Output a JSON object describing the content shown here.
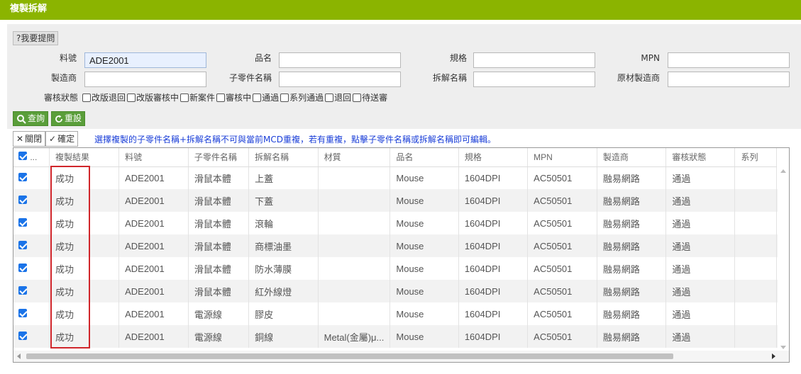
{
  "title": "複製拆解",
  "help_label": "?我要提問",
  "search": {
    "part_no_label": "料號",
    "part_no_value": "ADE2001",
    "name_label": "品名",
    "name_value": "",
    "spec_label": "規格",
    "spec_value": "",
    "mpn_label": "MPN",
    "mpn_value": "",
    "maker_label": "製造商",
    "maker_value": "",
    "subpart_label": "子零件名稱",
    "subpart_value": "",
    "disassembly_label": "拆解名稱",
    "disassembly_value": "",
    "raw_maker_label": "原材製造商",
    "raw_maker_value": ""
  },
  "status_filter": {
    "label": "審核狀態",
    "options": [
      "改版退回",
      "改版審核中",
      "新案件",
      "審核中",
      "通過",
      "系列通過",
      "退回",
      "待送審"
    ]
  },
  "buttons": {
    "query": "查詢",
    "reset": "重設",
    "close": "關閉",
    "confirm": "確定"
  },
  "notice": "選擇複製的子零件名稱+拆解名稱不可與當前MCD重複，若有重複，點擊子零件名稱或拆解名稱即可編輯。",
  "table": {
    "select_all_checked": true,
    "header_ellipsis": "...",
    "columns": [
      "複製結果",
      "料號",
      "子零件名稱",
      "拆解名稱",
      "材質",
      "品名",
      "規格",
      "MPN",
      "製造商",
      "審核狀態",
      "系列"
    ],
    "rows": [
      {
        "checked": true,
        "result": "成功",
        "part_no": "ADE2001",
        "subpart": "滑鼠本體",
        "disassembly": "上蓋",
        "material": "",
        "name": "Mouse",
        "spec": "1604DPI",
        "mpn": "AC50501",
        "maker": "融易網路",
        "status": "通過",
        "series": ""
      },
      {
        "checked": true,
        "result": "成功",
        "part_no": "ADE2001",
        "subpart": "滑鼠本體",
        "disassembly": "下蓋",
        "material": "",
        "name": "Mouse",
        "spec": "1604DPI",
        "mpn": "AC50501",
        "maker": "融易網路",
        "status": "通過",
        "series": ""
      },
      {
        "checked": true,
        "result": "成功",
        "part_no": "ADE2001",
        "subpart": "滑鼠本體",
        "disassembly": "滾輪",
        "material": "",
        "name": "Mouse",
        "spec": "1604DPI",
        "mpn": "AC50501",
        "maker": "融易網路",
        "status": "通過",
        "series": ""
      },
      {
        "checked": true,
        "result": "成功",
        "part_no": "ADE2001",
        "subpart": "滑鼠本體",
        "disassembly": "商標油墨",
        "material": "",
        "name": "Mouse",
        "spec": "1604DPI",
        "mpn": "AC50501",
        "maker": "融易網路",
        "status": "通過",
        "series": ""
      },
      {
        "checked": true,
        "result": "成功",
        "part_no": "ADE2001",
        "subpart": "滑鼠本體",
        "disassembly": "防水薄膜",
        "material": "",
        "name": "Mouse",
        "spec": "1604DPI",
        "mpn": "AC50501",
        "maker": "融易網路",
        "status": "通過",
        "series": ""
      },
      {
        "checked": true,
        "result": "成功",
        "part_no": "ADE2001",
        "subpart": "滑鼠本體",
        "disassembly": "紅外線燈",
        "material": "",
        "name": "Mouse",
        "spec": "1604DPI",
        "mpn": "AC50501",
        "maker": "融易網路",
        "status": "通過",
        "series": ""
      },
      {
        "checked": true,
        "result": "成功",
        "part_no": "ADE2001",
        "subpart": "電源線",
        "disassembly": "膠皮",
        "material": "",
        "name": "Mouse",
        "spec": "1604DPI",
        "mpn": "AC50501",
        "maker": "融易網路",
        "status": "通過",
        "series": ""
      },
      {
        "checked": true,
        "result": "成功",
        "part_no": "ADE2001",
        "subpart": "電源線",
        "disassembly": "銅線",
        "material": "Metal(金屬)μ...",
        "name": "Mouse",
        "spec": "1604DPI",
        "mpn": "AC50501",
        "maker": "融易網路",
        "status": "通過",
        "series": ""
      }
    ]
  },
  "colors": {
    "titlebar": "#8bb400",
    "action_button": "#5a9e3a",
    "notice_text": "#1a3ed8",
    "highlight_box": "#d0262b",
    "checkbox": "#1a73e8"
  }
}
